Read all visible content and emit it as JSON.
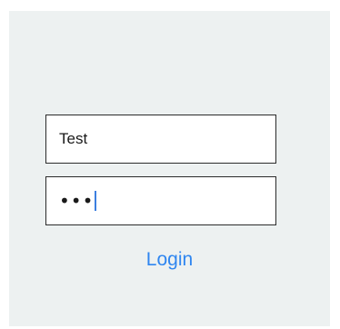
{
  "login_form": {
    "username_value": "Test",
    "password_masked": "•••",
    "login_label": "Login"
  },
  "colors": {
    "background": "#edf1f1",
    "field_border": "#2b2b2b",
    "accent": "#2f86f0",
    "caret": "#3c7fe0"
  }
}
